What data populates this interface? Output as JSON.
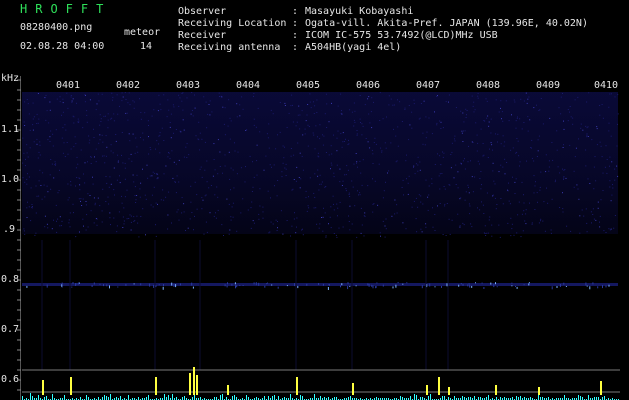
{
  "logo": "HROFFT",
  "file": "08280400.png",
  "datetime": "02.08.28 04:00",
  "meteor_label": "meteor",
  "meteor_count": "14",
  "info": [
    {
      "label": "Observer",
      "value": "Masayuki Kobayashi"
    },
    {
      "label": "Receiving Location",
      "value": "Ogata-vill. Akita-Pref. JAPAN (139.96E, 40.02N)"
    },
    {
      "label": "Receiver",
      "value": "ICOM IC-575 53.7492(@LCD)MHz USB"
    },
    {
      "label": "Receiving antenna",
      "value": "A504HB(yagi 4el)"
    }
  ],
  "y_unit": "kHz",
  "y_ticks": [
    "1.1",
    "1.0",
    ".9",
    "0.8",
    "0.7",
    "0.6"
  ],
  "x_ticks": [
    "0401",
    "0402",
    "0403",
    "0404",
    "0405",
    "0406",
    "0407",
    "0408",
    "0409",
    "0410"
  ],
  "colors": {
    "background": "#000000",
    "logo": "#2ee05a",
    "text": "#e6e6e6",
    "noise": "#1a1a6a",
    "signal": "#7ab0ff",
    "meteor_bar": "#ffff40",
    "baseline": "#30ffff"
  }
}
